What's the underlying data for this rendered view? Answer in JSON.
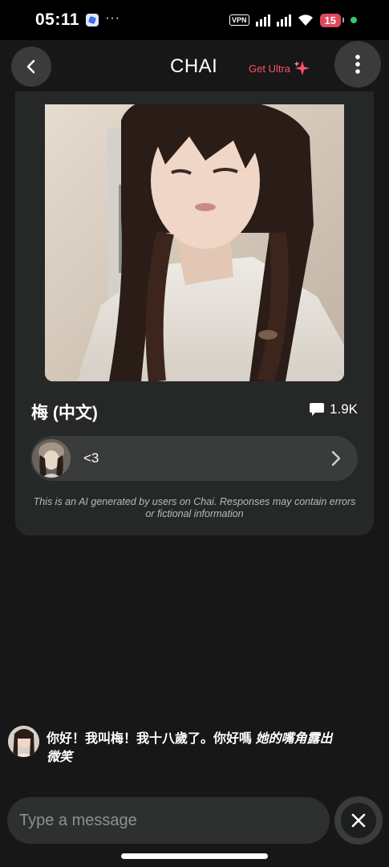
{
  "status_bar": {
    "time": "05:11",
    "dots": "···",
    "vpn_label": "VPN",
    "battery_level": "15"
  },
  "header": {
    "app_title": "CHAI",
    "get_ultra_label": "Get Ultra"
  },
  "character": {
    "name": "梅 (中文)",
    "message_count": "1.9K",
    "creator_name": "<3",
    "disclaimer": "This is an AI generated by users on Chai. Responses may contain errors or fictional information"
  },
  "chat": {
    "message_text": "你好！我叫梅！我十八歲了。你好嗎 ",
    "message_action": "她的嘴角露出微笑"
  },
  "composer": {
    "placeholder": "Type a message"
  },
  "colors": {
    "background": "#171717",
    "card": "#262828",
    "accent_ultra": "#ff4f6d",
    "battery": "#e0475a",
    "online_dot": "#2ecc71"
  },
  "icons": [
    "back-arrow-icon",
    "more-vert-icon",
    "sparkle-icon",
    "chat-bubble-icon",
    "chevron-right-icon",
    "close-icon",
    "wifi-icon",
    "signal-icon"
  ]
}
